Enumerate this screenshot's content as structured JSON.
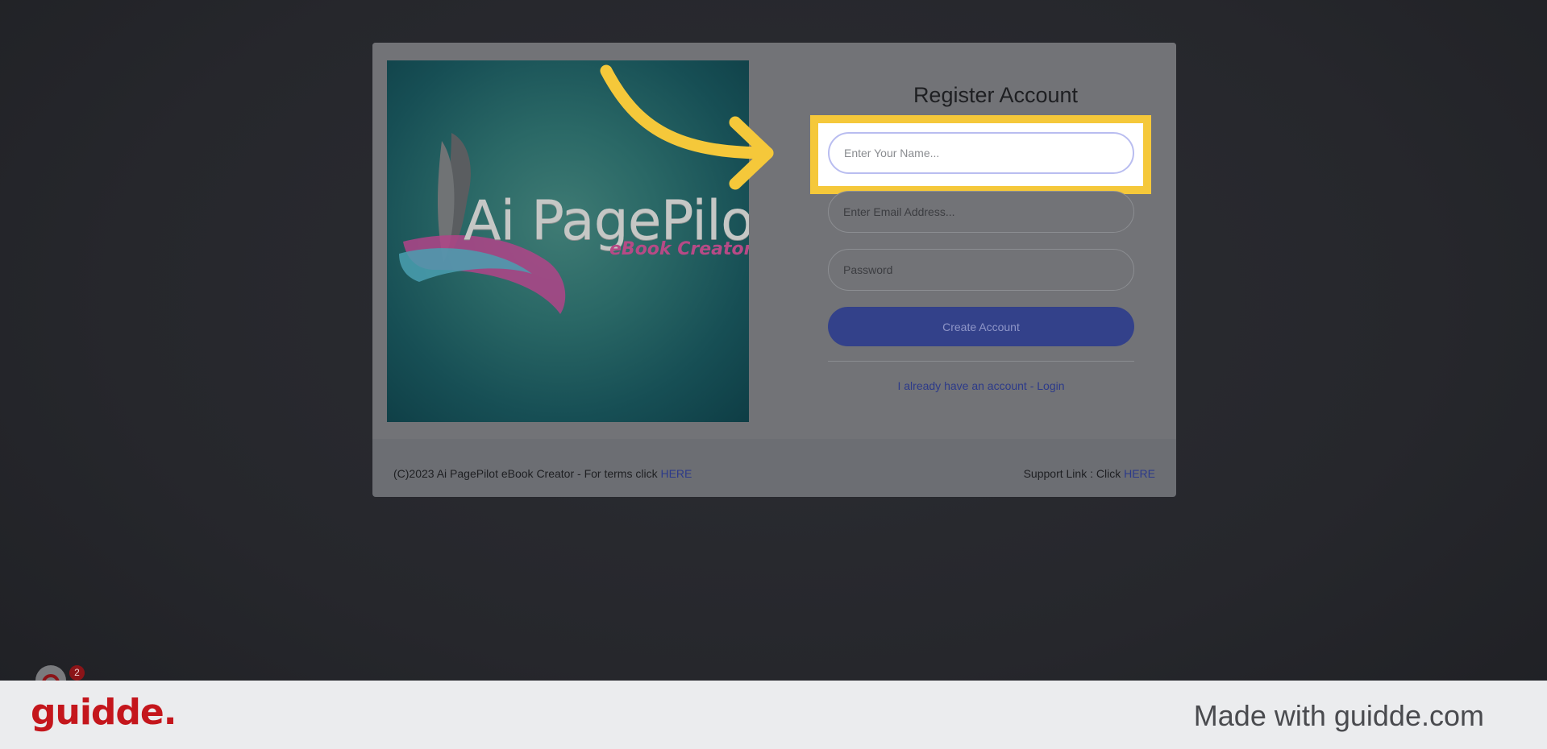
{
  "logo": {
    "title": "Ai PagePilot",
    "subtitle": "eBook Creator."
  },
  "form": {
    "title": "Register Account",
    "name_placeholder": "Enter Your Name...",
    "email_placeholder": "Enter Email Address...",
    "password_placeholder": "Password",
    "create_button": "Create Account",
    "login_link": "I already have an account - Login"
  },
  "footer": {
    "copyright": "(C)2023 Ai PagePilot eBook Creator - For terms click ",
    "terms_link": "HERE",
    "support_label": "Support Link : Click ",
    "support_link": "HERE"
  },
  "guidde": {
    "brand": "guidde.",
    "made_with": "Made with guidde.com",
    "notification_count": "2"
  },
  "colors": {
    "highlight": "#f5c83a",
    "primary_button": "#33418a",
    "brand_red": "#c4161c"
  }
}
